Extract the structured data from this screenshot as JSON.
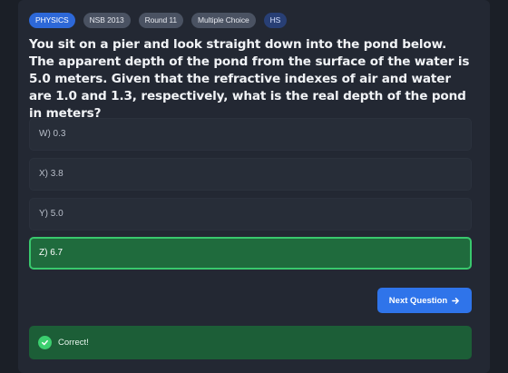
{
  "tags": {
    "subject": "PHYSICS",
    "competition": "NSB 2013",
    "round": "Round 11",
    "format": "Multiple Choice",
    "level": "HS"
  },
  "question": {
    "text": "You sit on a pier and look straight down into the pond below. The apparent depth of the pond from the surface of the water is 5.0 meters. Given that the refractive indexes of air and water are 1.0 and 1.3, respectively, what is the real depth of the pond in meters?"
  },
  "options": [
    {
      "label": "W) 0.3",
      "state": "default"
    },
    {
      "label": "X) 3.8",
      "state": "default"
    },
    {
      "label": "Y) 5.0",
      "state": "default"
    },
    {
      "label": "Z) 6.7",
      "state": "correct"
    }
  ],
  "next_button": {
    "label": "Next Question",
    "icon": "arrow-right-icon"
  },
  "feedback": {
    "text": "Correct!",
    "icon": "check-circle-icon"
  },
  "colors": {
    "background": "#1b1f27",
    "card": "#232833",
    "subject_tag": "#2d68d8",
    "neutral_tag": "#4a5262",
    "level_tag": "#283f75",
    "correct_border": "#39c86d",
    "correct_fill": "#1f6b3d",
    "primary_button": "#2f74ea",
    "feedback_fill": "#1c5e37"
  }
}
